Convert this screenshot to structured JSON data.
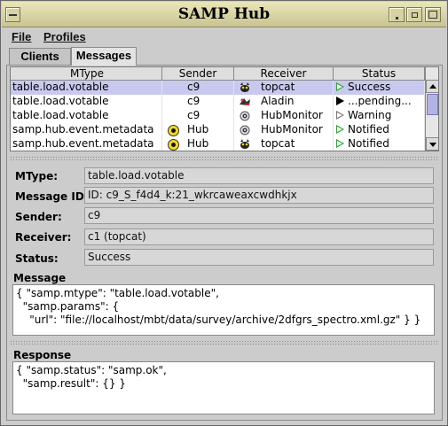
{
  "window": {
    "title": "SAMP Hub"
  },
  "menu": {
    "file": "File",
    "profiles": "Profiles"
  },
  "tabs": {
    "clients": "Clients",
    "messages": "Messages"
  },
  "table": {
    "headers": [
      "MType",
      "Sender",
      "Receiver",
      "Status"
    ],
    "rows": [
      {
        "mtype": "table.load.votable",
        "sender": "c9",
        "sender_icon": "none",
        "receiver": "topcat",
        "receiver_icon": "topcat-icon",
        "status": "Success",
        "status_icon": "green-triangle-hollow",
        "selected": true
      },
      {
        "mtype": "table.load.votable",
        "sender": "c9",
        "sender_icon": "none",
        "receiver": "Aladin",
        "receiver_icon": "aladin-icon",
        "status": "...pending...",
        "status_icon": "black-triangle",
        "selected": false
      },
      {
        "mtype": "table.load.votable",
        "sender": "c9",
        "sender_icon": "none",
        "receiver": "HubMonitor",
        "receiver_icon": "hubmonitor-icon",
        "status": "Warning",
        "status_icon": "outline-triangle",
        "selected": false
      },
      {
        "mtype": "samp.hub.event.metadata",
        "sender": "Hub",
        "sender_icon": "hub-icon",
        "receiver": "HubMonitor",
        "receiver_icon": "hubmonitor-icon",
        "status": "Notified",
        "status_icon": "green-triangle-hollow",
        "selected": false
      },
      {
        "mtype": "samp.hub.event.metadata",
        "sender": "Hub",
        "sender_icon": "hub-icon",
        "receiver": "topcat",
        "receiver_icon": "topcat-icon",
        "status": "Notified",
        "status_icon": "green-triangle-hollow",
        "selected": false
      }
    ]
  },
  "details": {
    "mtype_label": "MType:",
    "mtype_value": "table.load.votable",
    "message_id_label": "Message ID:",
    "message_id_value": "ID: c9_S_f4d4_k:21_wkrcaweaxcwdhkjx",
    "sender_label": "Sender:",
    "sender_value": "c9",
    "receiver_label": "Receiver:",
    "receiver_value": "c1 (topcat)",
    "status_label": "Status:",
    "status_value": "Success"
  },
  "message": {
    "label": "Message",
    "text": "{ \"samp.mtype\": \"table.load.votable\",\n  \"samp.params\": {\n    \"url\": \"file://localhost/mbt/data/survey/archive/2dfgrs_spectro.xml.gz\" } }"
  },
  "response": {
    "label": "Response",
    "text": "{ \"samp.status\": \"samp.ok\",\n  \"samp.result\": {} }"
  },
  "colors": {
    "selection": "#c9c9f0",
    "status_green": "#2fa22f",
    "hub_yellow": "#f4d81f",
    "titlebar": "#d9d5a6"
  }
}
